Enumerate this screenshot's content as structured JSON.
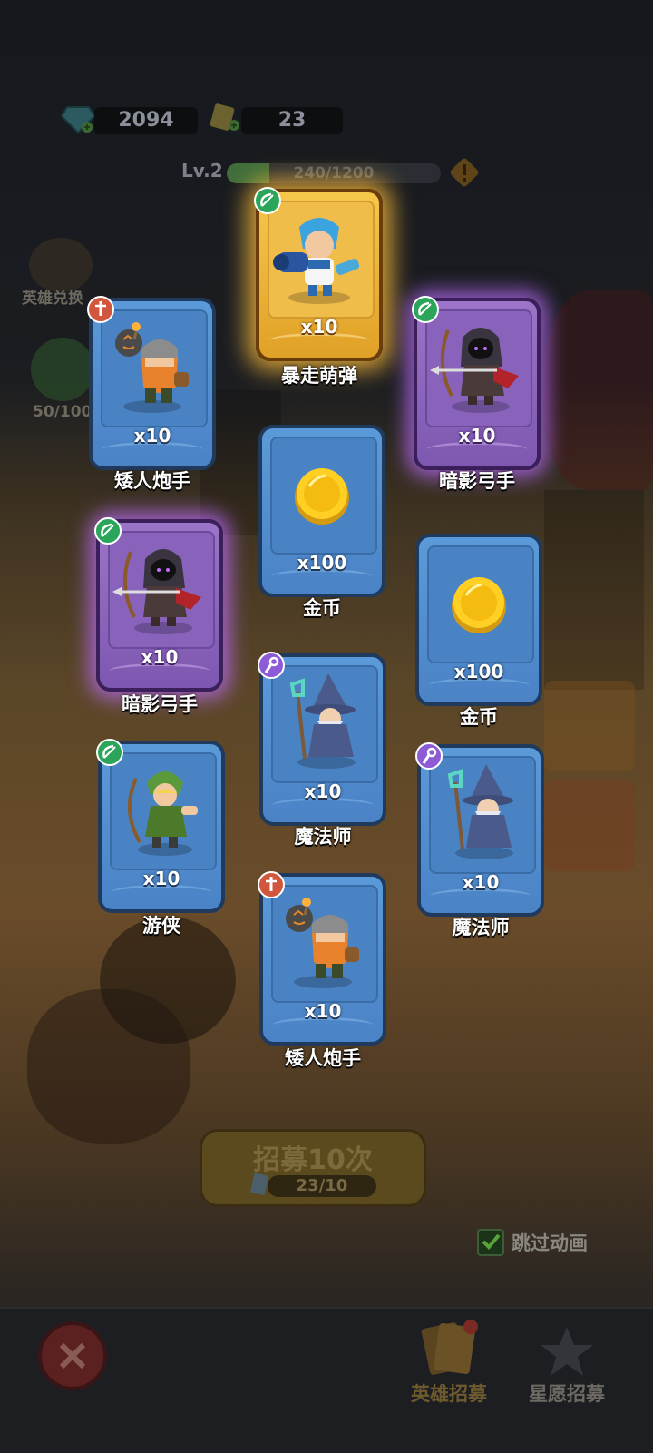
{
  "resources": {
    "gems": "2094",
    "tickets": "23"
  },
  "level": {
    "label": "Lv.2",
    "xp_text": "240/1200",
    "xp_fraction": 0.2
  },
  "side": {
    "hero_exchange": "英雄兑换",
    "progress": "50/100"
  },
  "cards": [
    {
      "id": "c1",
      "name": "暴走萌弹",
      "qty": "x10",
      "rarity": "gold",
      "badge": "bow",
      "art": "gunner"
    },
    {
      "id": "c2",
      "name": "矮人炮手",
      "qty": "x10",
      "rarity": "blue",
      "badge": "sword",
      "art": "dwarf"
    },
    {
      "id": "c3",
      "name": "暗影弓手",
      "qty": "x10",
      "rarity": "purple",
      "badge": "bow",
      "art": "shadow-archer"
    },
    {
      "id": "c4",
      "name": "金币",
      "qty": "x100",
      "rarity": "blue",
      "badge": "",
      "art": "coin"
    },
    {
      "id": "c5",
      "name": "暗影弓手",
      "qty": "x10",
      "rarity": "purple",
      "badge": "bow",
      "art": "shadow-archer"
    },
    {
      "id": "c6",
      "name": "金币",
      "qty": "x100",
      "rarity": "blue",
      "badge": "",
      "art": "coin"
    },
    {
      "id": "c7",
      "name": "魔法师",
      "qty": "x10",
      "rarity": "blue",
      "badge": "staff",
      "art": "wizard"
    },
    {
      "id": "c8",
      "name": "游侠",
      "qty": "x10",
      "rarity": "blue",
      "badge": "bow",
      "art": "ranger"
    },
    {
      "id": "c9",
      "name": "魔法师",
      "qty": "x10",
      "rarity": "blue",
      "badge": "staff",
      "art": "wizard"
    },
    {
      "id": "c10",
      "name": "矮人炮手",
      "qty": "x10",
      "rarity": "blue",
      "badge": "sword",
      "art": "dwarf"
    }
  ],
  "recruit": {
    "label": "招募10次",
    "count": "23/10"
  },
  "skip": {
    "label": "跳过动画",
    "checked": true
  },
  "bottom_tabs": {
    "hero_recruit": "英雄招募",
    "wish_recruit": "星愿招募"
  },
  "colors": {
    "gold_glow": "#ffbe3c",
    "purple_glow": "#be6eff",
    "card_blue": "#5b9ad8"
  }
}
